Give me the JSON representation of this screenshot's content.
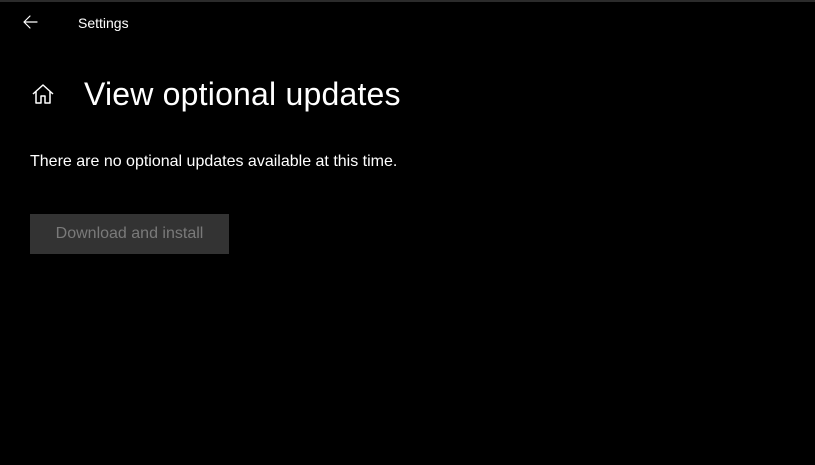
{
  "titlebar": {
    "back_icon": "back-arrow-icon",
    "title": "Settings"
  },
  "header": {
    "home_icon": "home-icon",
    "title": "View optional updates"
  },
  "main": {
    "status_text": "There are no optional updates available at this time.",
    "download_button_label": "Download and install",
    "download_button_enabled": false
  },
  "colors": {
    "background": "#000000",
    "text": "#ffffff",
    "button_background_disabled": "#333333",
    "button_text_disabled": "#7a7a7a"
  }
}
